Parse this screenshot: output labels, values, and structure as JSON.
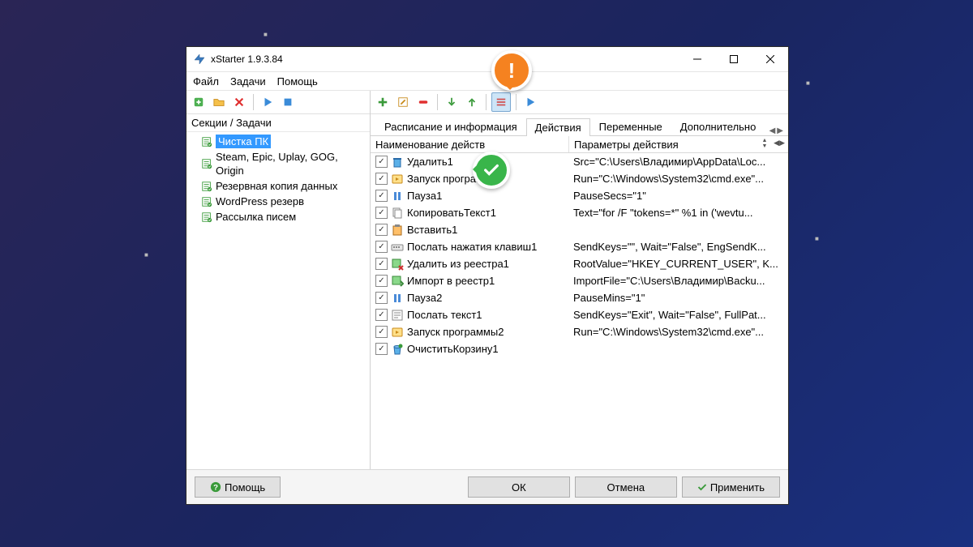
{
  "window": {
    "title": "xStarter 1.9.3.84"
  },
  "menu": {
    "file": "Файл",
    "tasks": "Задачи",
    "help": "Помощь"
  },
  "tree": {
    "header": "Секции / Задачи",
    "items": [
      {
        "label": "Чистка ПК",
        "selected": true
      },
      {
        "label": "Steam, Epic, Uplay, GOG, Origin",
        "selected": false
      },
      {
        "label": "Резервная копия данных",
        "selected": false
      },
      {
        "label": "WordPress резерв",
        "selected": false
      },
      {
        "label": "Рассылка писем",
        "selected": false
      }
    ]
  },
  "tabs": {
    "schedule": "Расписание и информация",
    "actions": "Действия",
    "vars": "Переменные",
    "extra": "Дополнительно"
  },
  "grid": {
    "col1": "Наименование действ",
    "col2": "Параметры действия",
    "rows": [
      {
        "name": "Удалить1",
        "params": "Src=\"C:\\Users\\Владимир\\AppData\\Loc...",
        "icon": "trash"
      },
      {
        "name": "Запуск програм",
        "params": "Run=\"C:\\Windows\\System32\\cmd.exe\"...",
        "icon": "run"
      },
      {
        "name": "Пауза1",
        "params": "PauseSecs=\"1\"",
        "icon": "pause"
      },
      {
        "name": "КопироватьТекст1",
        "params": "Text=\"for /F \"tokens=*\" %1 in ('wevtu...",
        "icon": "copy"
      },
      {
        "name": "Вставить1",
        "params": "",
        "icon": "paste"
      },
      {
        "name": "Послать нажатия клавиш1",
        "params": "SendKeys=\"\", Wait=\"False\", EngSendK...",
        "icon": "keys"
      },
      {
        "name": "Удалить из реестра1",
        "params": "RootValue=\"HKEY_CURRENT_USER\", K...",
        "icon": "regdel"
      },
      {
        "name": "Импорт в реестр1",
        "params": "ImportFile=\"C:\\Users\\Владимир\\Backu...",
        "icon": "regimp"
      },
      {
        "name": "Пауза2",
        "params": "PauseMins=\"1\"",
        "icon": "pause"
      },
      {
        "name": "Послать текст1",
        "params": "SendKeys=\"Exit\", Wait=\"False\", FullPat...",
        "icon": "text"
      },
      {
        "name": "Запуск программы2",
        "params": "Run=\"C:\\Windows\\System32\\cmd.exe\"...",
        "icon": "run"
      },
      {
        "name": "ОчиститьКорзину1",
        "params": "",
        "icon": "bin"
      }
    ]
  },
  "footer": {
    "help": "Помощь",
    "ok": "ОК",
    "cancel": "Отмена",
    "apply": "Применить"
  }
}
